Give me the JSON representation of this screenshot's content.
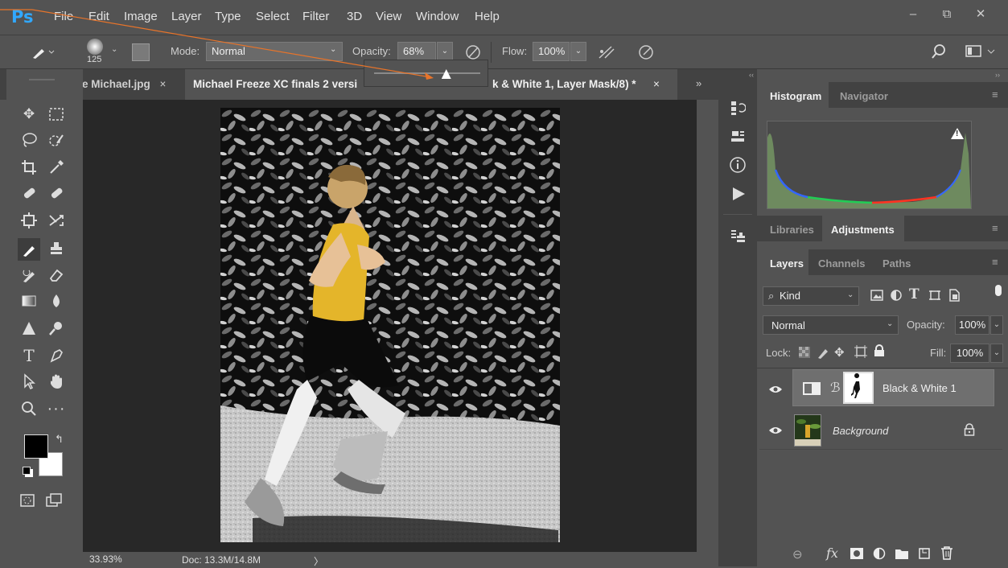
{
  "app": {
    "logo": "Ps",
    "menus": [
      "File",
      "Edit",
      "Image",
      "Layer",
      "Type",
      "Select",
      "Filter",
      "3D",
      "View",
      "Window",
      "Help"
    ],
    "window_controls": {
      "minimize": "–",
      "restore": "⧉",
      "close": "✕"
    }
  },
  "options": {
    "brush_size": "125",
    "mode_label": "Mode:",
    "mode_value": "Normal",
    "opacity_label": "Opacity:",
    "opacity_value": "68%",
    "flow_label": "Flow:",
    "flow_value": "100%",
    "collapse_left": "‹‹",
    "collapse_right": "››"
  },
  "slider": {
    "value_fraction": 0.68
  },
  "tabs": {
    "tab1_title": "e Michael.jpg",
    "tab1_close": "×",
    "tab2_title_left": "Michael Freeze XC finals 2 versi",
    "tab2_title_right": "k & White 1, Layer Mask/8) *",
    "tab2_close": "×",
    "overflow": "»"
  },
  "status": {
    "zoom": "33.93%",
    "doc": "Doc: 13.3M/14.8M",
    "arrow": "〉"
  },
  "panels": {
    "histogram_tab": "Histogram",
    "navigator_tab": "Navigator",
    "libraries_tab": "Libraries",
    "adjustments_tab": "Adjustments",
    "layers_tab": "Layers",
    "channels_tab": "Channels",
    "paths_tab": "Paths",
    "kind_label": "Kind",
    "blend_mode": "Normal",
    "opacity_label": "Opacity:",
    "opacity_value": "100%",
    "lock_label": "Lock:",
    "fill_label": "Fill:",
    "fill_value": "100%",
    "warning": "!"
  },
  "layers": [
    {
      "name": "Black & White 1",
      "selected": true
    },
    {
      "name": "Background",
      "selected": false
    }
  ],
  "colors": {
    "accent": "#31a8ff",
    "panel_bg": "#535353",
    "dark_bg": "#282828",
    "selected_layer": "#6f6f6f",
    "arrow": "#e8742a"
  }
}
